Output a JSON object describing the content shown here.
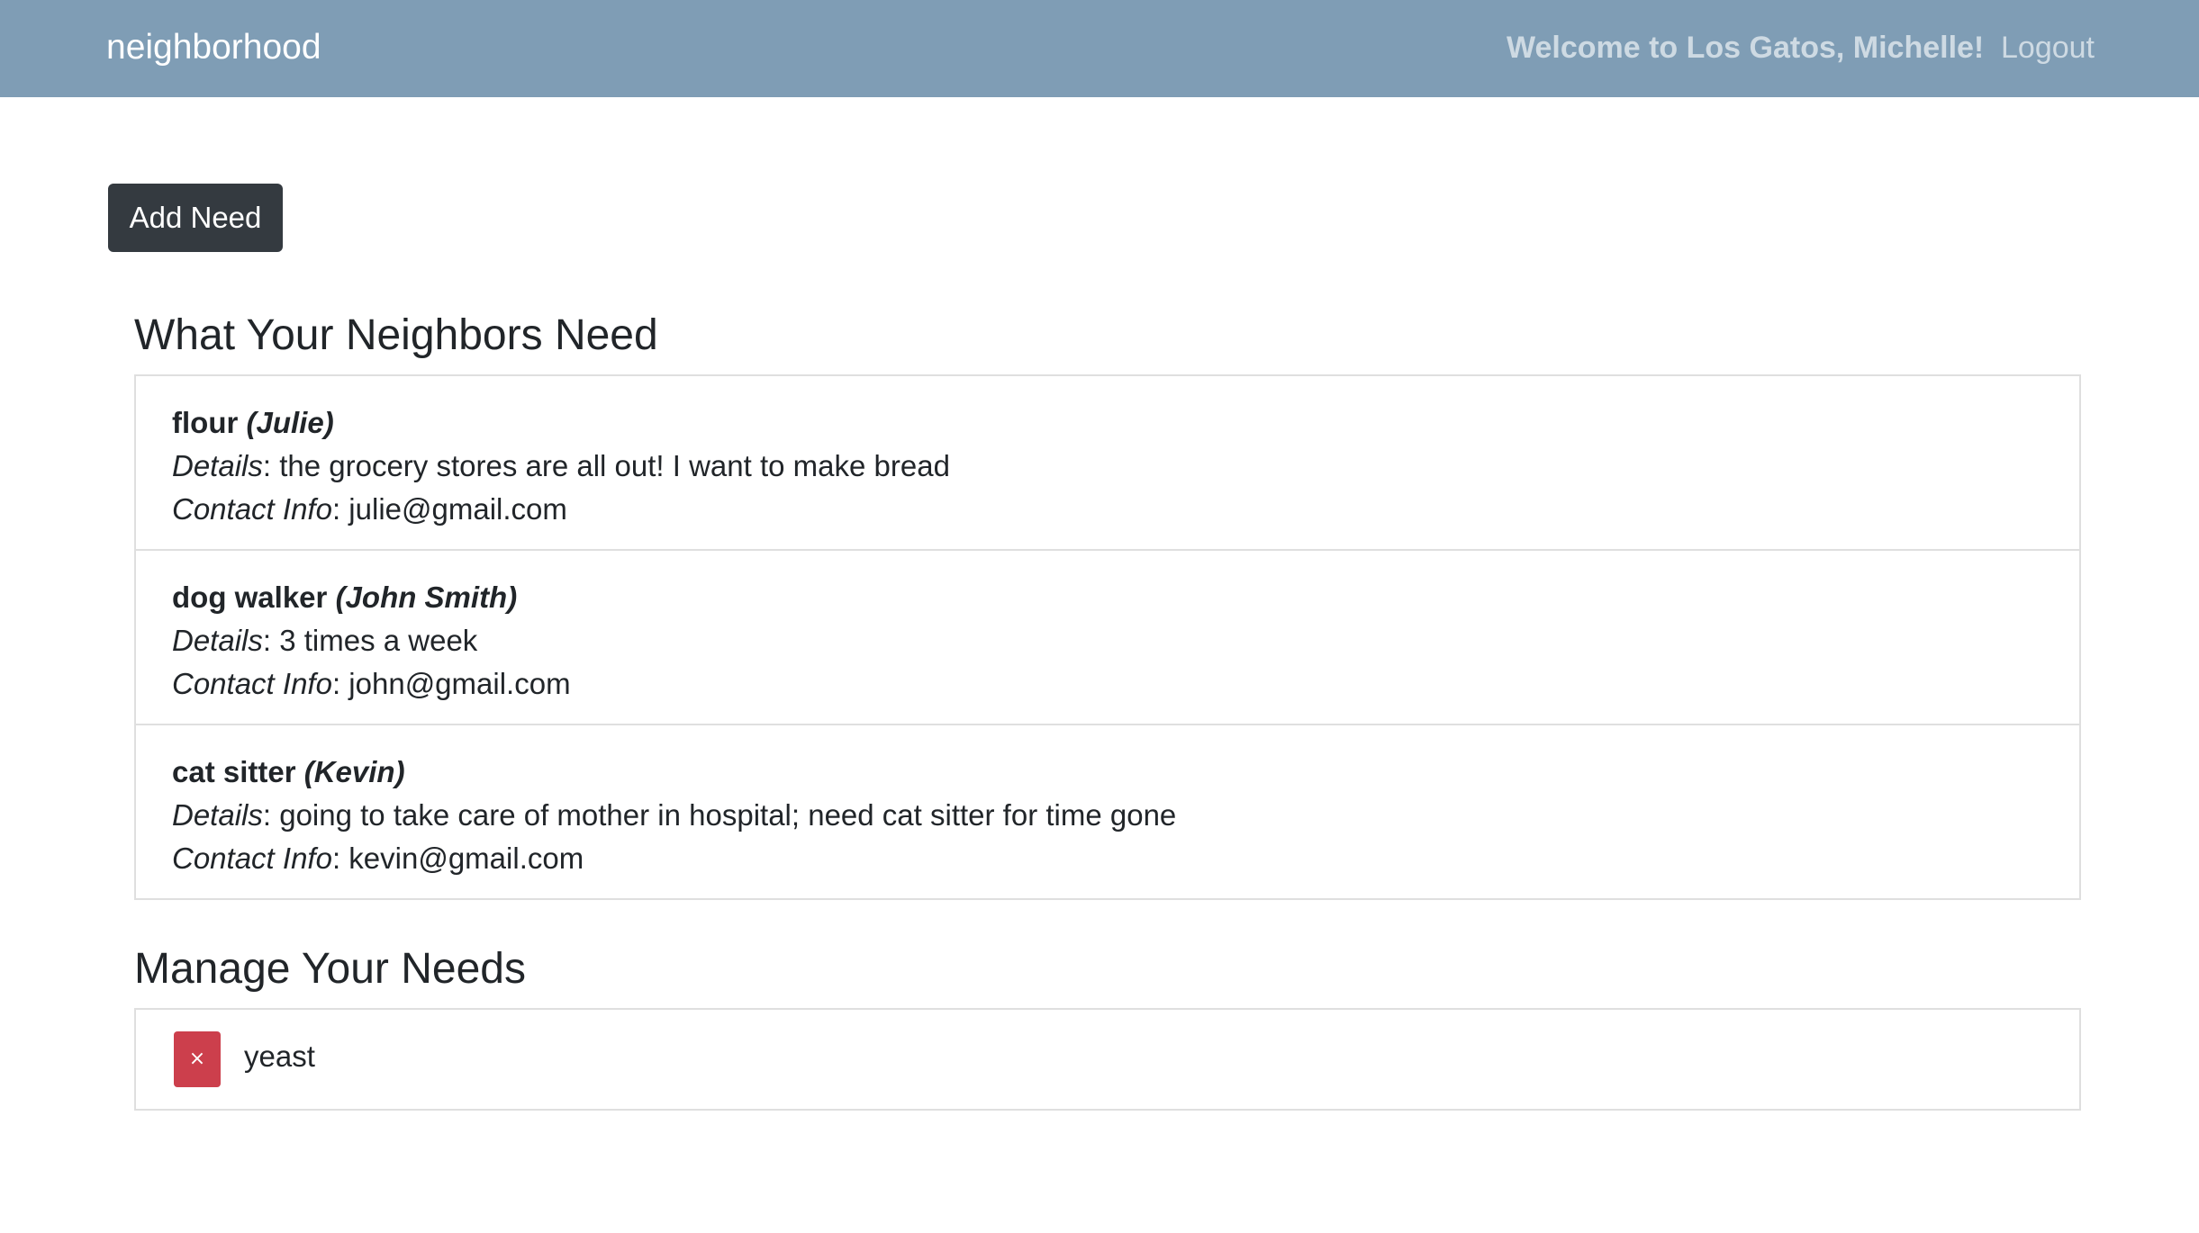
{
  "navbar": {
    "brand": "neighborhood",
    "welcome": "Welcome to Los Gatos, Michelle!",
    "logout": "Logout",
    "background_color": "#7f9db5"
  },
  "actions": {
    "add_need": "Add Need"
  },
  "neighbors_section": {
    "title": "What Your Neighbors Need",
    "details_label": "Details",
    "contact_label": "Contact Info",
    "needs": [
      {
        "item": "flour",
        "requester": "(Julie)",
        "details": "the grocery stores are all out! I want to make bread",
        "contact": "julie@gmail.com"
      },
      {
        "item": "dog walker",
        "requester": "(John Smith)",
        "details": "3 times a week",
        "contact": "john@gmail.com"
      },
      {
        "item": "cat sitter",
        "requester": "(Kevin)",
        "details": "going to take care of mother in hospital; need cat sitter for time gone",
        "contact": "kevin@gmail.com"
      }
    ]
  },
  "manage_section": {
    "title": "Manage Your Needs",
    "delete_icon": "×",
    "delete_color": "#cc3f4c",
    "my_needs": [
      {
        "item": "yeast"
      }
    ]
  }
}
